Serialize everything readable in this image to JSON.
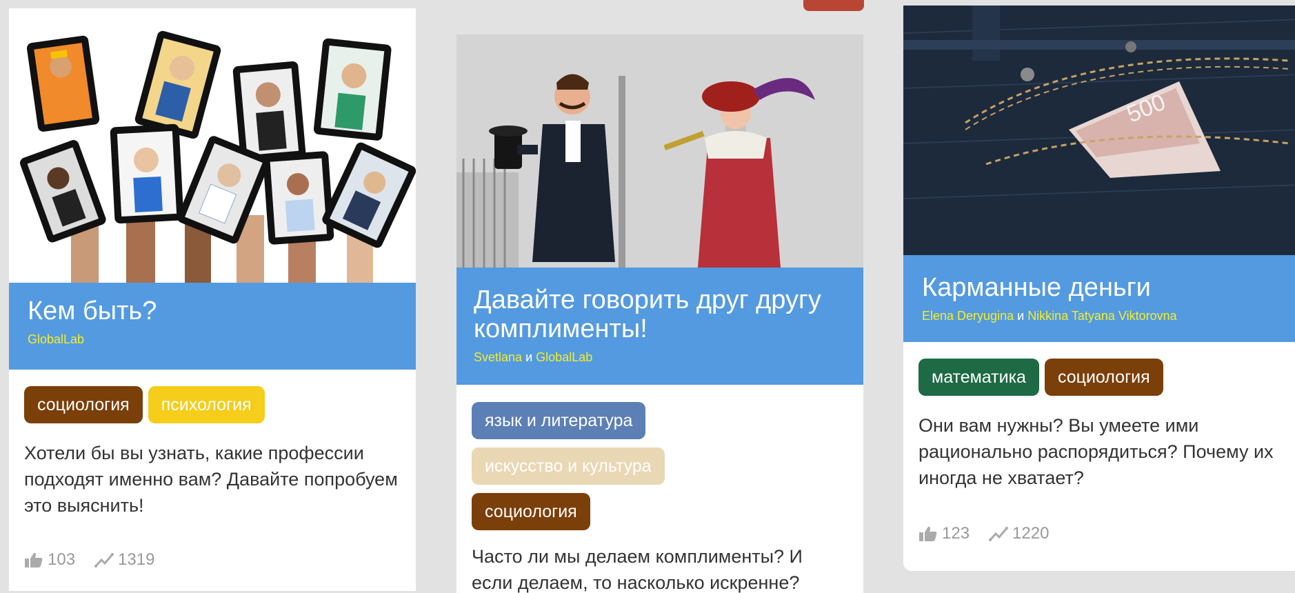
{
  "cards": [
    {
      "title": "Кем быть?",
      "authors": [
        "GlobalLab"
      ],
      "author_joiner": "",
      "tags": [
        {
          "label": "социология",
          "color": "#7b3f0a"
        },
        {
          "label": "психология",
          "color": "#f5cd1a"
        }
      ],
      "description": "Хотели бы вы узнать, какие профессии подходят именно вам? Давайте попробуем это выяснить!",
      "likes": "103",
      "views": "1319",
      "image_icon": "tablets-portraits-image"
    },
    {
      "title": "Давайте говорить друг другу комплименты!",
      "authors": [
        "Svetlana",
        "GlobalLab"
      ],
      "author_joiner": "и",
      "tags": [
        {
          "label": "язык и литература",
          "color": "#5c7fb6"
        },
        {
          "label": "искусство и культура",
          "color": "#ead7b4"
        },
        {
          "label": "социология",
          "color": "#7b3f0a"
        }
      ],
      "description": "Часто ли мы делаем комплименты? И если делаем, то насколько искренне?",
      "image_icon": "vintage-couple-image"
    },
    {
      "title": "Карманные деньги",
      "authors": [
        "Elena Deryugina",
        "Nikkina Tatyana Viktorovna"
      ],
      "author_joiner": "и",
      "tags": [
        {
          "label": "математика",
          "color": "#1d6a45"
        },
        {
          "label": "социология",
          "color": "#7b3f0a"
        }
      ],
      "description": "Они вам нужны? Вы умеете ими рационально распорядиться? Почему их иногда не хватает?",
      "likes": "123",
      "views": "1220",
      "image_icon": "jeans-pocket-banknote-image"
    }
  ],
  "colors": {
    "banner": "#549ae0",
    "author_link": "#f5ee28",
    "stat_text": "#999999",
    "background": "#e2e2e2"
  },
  "icons": {
    "likes": "thumbs-up-icon",
    "views": "trend-chart-icon"
  }
}
